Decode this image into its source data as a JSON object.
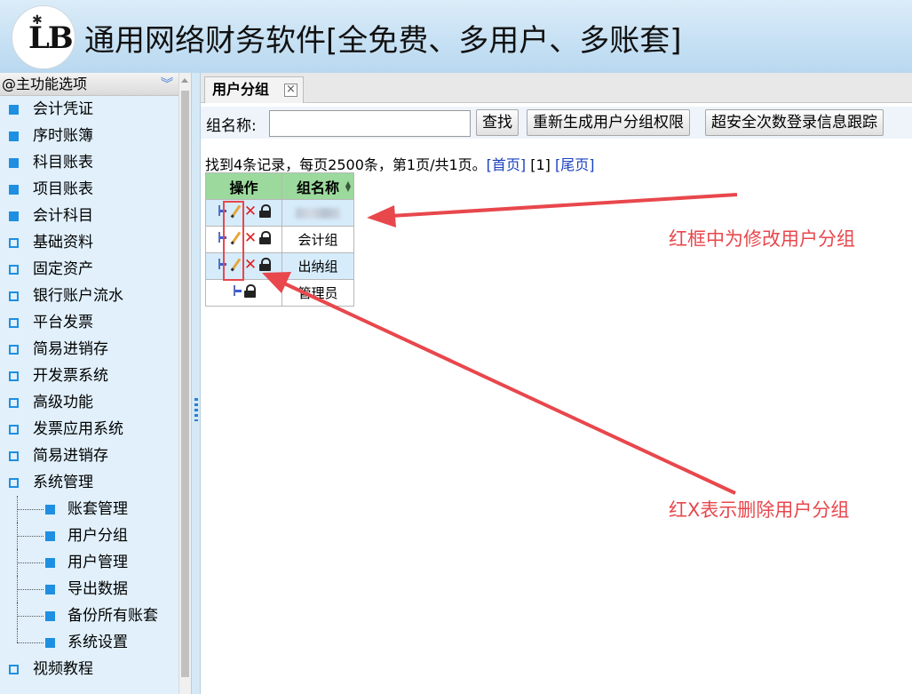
{
  "header": {
    "logo_text": "LB",
    "title": "通用网络财务软件[全免费、多用户、多账套]"
  },
  "nav": {
    "head_label": "@主功能选项",
    "items": [
      {
        "label": "会计凭证",
        "style": "solid"
      },
      {
        "label": "序时账簿",
        "style": "solid"
      },
      {
        "label": "科目账表",
        "style": "solid"
      },
      {
        "label": "项目账表",
        "style": "solid"
      },
      {
        "label": "会计科目",
        "style": "solid"
      },
      {
        "label": "基础资料",
        "style": "hollow"
      },
      {
        "label": "固定资产",
        "style": "hollow"
      },
      {
        "label": "银行账户流水",
        "style": "hollow"
      },
      {
        "label": "平台发票",
        "style": "hollow"
      },
      {
        "label": "简易进销存",
        "style": "hollow"
      },
      {
        "label": "开发票系统",
        "style": "hollow"
      },
      {
        "label": "高级功能",
        "style": "hollow"
      },
      {
        "label": "发票应用系统",
        "style": "hollow"
      },
      {
        "label": "简易进销存",
        "style": "hollow"
      },
      {
        "label": "系统管理",
        "style": "hollow"
      }
    ],
    "sub_items": [
      "账套管理",
      "用户分组",
      "用户管理",
      "导出数据",
      "备份所有账套",
      "系统设置"
    ],
    "tail_items": [
      {
        "label": "视频教程",
        "style": "hollow"
      }
    ]
  },
  "tab": {
    "label": "用户分组",
    "close": "×"
  },
  "toolbar": {
    "name_label": "组名称:",
    "name_value": "",
    "search_label": "查找",
    "regen_label": "重新生成用户分组权限",
    "track_label": "超安全次数登录信息跟踪"
  },
  "summary": {
    "text": "找到4条记录，每页2500条，第1页/共1页。",
    "first": "[首页]",
    "page": "[1]",
    "last": "[尾页]"
  },
  "table": {
    "headers": [
      "操作",
      "组名称"
    ],
    "rows": [
      {
        "name": "",
        "redacted": true,
        "ops": "full"
      },
      {
        "name": "会计组",
        "redacted": false,
        "ops": "full"
      },
      {
        "name": "出纳组",
        "redacted": false,
        "ops": "full"
      },
      {
        "name": "管理员",
        "redacted": false,
        "ops": "limited"
      }
    ]
  },
  "annotations": {
    "edit_note": "红框中为修改用户分组",
    "delete_note": "红X表示删除用户分组",
    "color": "#e8474c"
  }
}
